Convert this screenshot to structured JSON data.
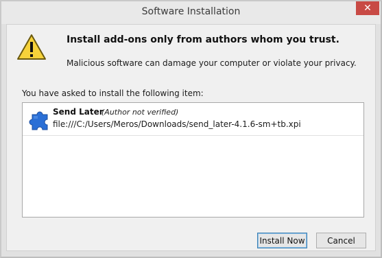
{
  "window": {
    "title": "Software Installation",
    "close_symbol": "✕"
  },
  "warning": {
    "icon": "warning-triangle-icon",
    "heading": "Install add-ons only from authors whom you trust.",
    "subtext": "Malicious software can damage your computer or violate your privacy."
  },
  "list": {
    "label": "You have asked to install the following item:",
    "items": [
      {
        "icon": "puzzle-piece-icon",
        "name": "Send Later",
        "author_note": "(Author not verified)",
        "path": "file:///C:/Users/Meros/Downloads/send_later-4.1.6-sm+tb.xpi"
      }
    ]
  },
  "buttons": {
    "install": "Install Now",
    "cancel": "Cancel"
  },
  "colors": {
    "close_button": "#c84a45",
    "warning_fill": "#f6d23a",
    "addon_icon": "#2a6fd6"
  }
}
